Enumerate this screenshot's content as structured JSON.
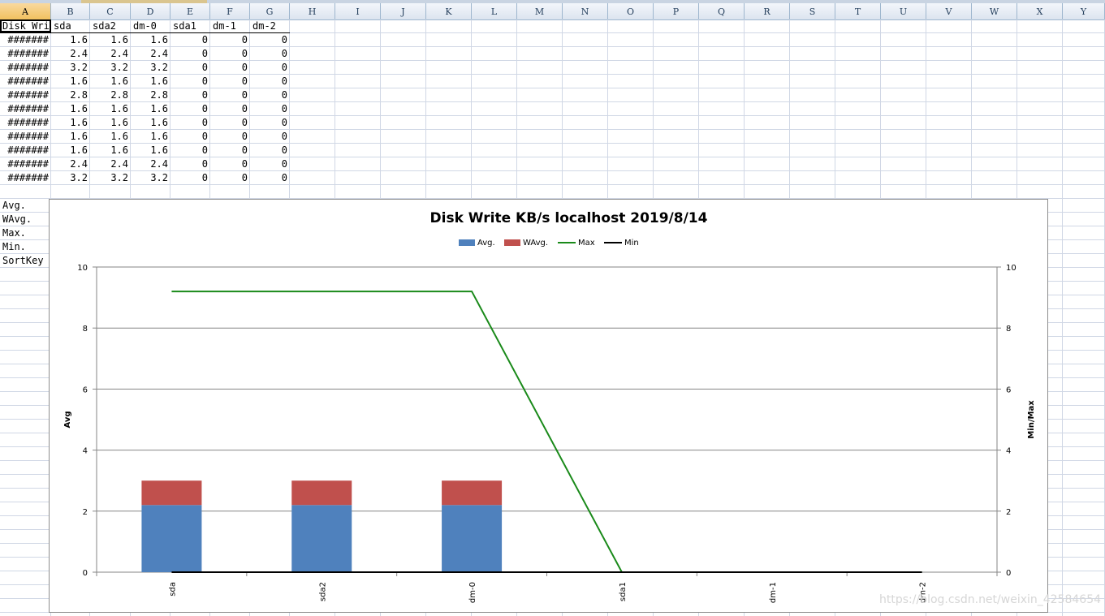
{
  "columns": [
    "A",
    "B",
    "C",
    "D",
    "E",
    "F",
    "G",
    "H",
    "I",
    "J",
    "K",
    "L",
    "M",
    "N",
    "O",
    "P",
    "Q",
    "R",
    "S",
    "T",
    "U",
    "V",
    "W",
    "X",
    "Y"
  ],
  "selected_column": "A",
  "header_row": [
    "Disk Write KB/s localhost",
    "sda",
    "sda2",
    "dm-0",
    "sda1",
    "dm-1",
    "dm-2"
  ],
  "data_rows": [
    [
      "#######",
      "1.6",
      "1.6",
      "1.6",
      "0",
      "0",
      "0"
    ],
    [
      "#######",
      "2.4",
      "2.4",
      "2.4",
      "0",
      "0",
      "0"
    ],
    [
      "#######",
      "3.2",
      "3.2",
      "3.2",
      "0",
      "0",
      "0"
    ],
    [
      "#######",
      "1.6",
      "1.6",
      "1.6",
      "0",
      "0",
      "0"
    ],
    [
      "#######",
      "2.8",
      "2.8",
      "2.8",
      "0",
      "0",
      "0"
    ],
    [
      "#######",
      "1.6",
      "1.6",
      "1.6",
      "0",
      "0",
      "0"
    ],
    [
      "#######",
      "1.6",
      "1.6",
      "1.6",
      "0",
      "0",
      "0"
    ],
    [
      "#######",
      "1.6",
      "1.6",
      "1.6",
      "0",
      "0",
      "0"
    ],
    [
      "#######",
      "1.6",
      "1.6",
      "1.6",
      "0",
      "0",
      "0"
    ],
    [
      "#######",
      "2.4",
      "2.4",
      "2.4",
      "0",
      "0",
      "0"
    ],
    [
      "#######",
      "3.2",
      "3.2",
      "3.2",
      "0",
      "0",
      "0"
    ]
  ],
  "summary_labels": [
    "Avg.",
    "WAvg.",
    "Max.",
    "Min.",
    "SortKey"
  ],
  "watermark": "https://blog.csdn.net/weixin_42584654",
  "colors": {
    "avg": "#4f81bd",
    "wavg": "#c0504d",
    "max": "#1a8a1a",
    "min": "#000000",
    "grid": "#868686",
    "header_bg": "#dce4ef",
    "selected_header": "#f1c15f"
  },
  "chart_data": {
    "type": "bar",
    "title": "Disk Write KB/s localhost  2019/8/14",
    "categories": [
      "sda",
      "sda2",
      "dm-0",
      "sda1",
      "dm-1",
      "dm-2"
    ],
    "stacked": true,
    "series": [
      {
        "name": "Avg.",
        "kind": "bar",
        "values": [
          2.2,
          2.2,
          2.2,
          0,
          0,
          0
        ]
      },
      {
        "name": "WAvg.",
        "kind": "bar",
        "values": [
          0.8,
          0.8,
          0.8,
          0,
          0,
          0
        ]
      },
      {
        "name": "Max",
        "kind": "line",
        "axis": "secondary",
        "values": [
          9.2,
          9.2,
          9.2,
          0,
          0,
          0
        ]
      },
      {
        "name": "Min",
        "kind": "line",
        "axis": "secondary",
        "values": [
          0,
          0,
          0,
          0,
          0,
          0
        ]
      }
    ],
    "ylabel": "Avg",
    "y2label": "Min/Max",
    "ylim": [
      0,
      10
    ],
    "y2lim": [
      0,
      10
    ],
    "yticks": [
      "0",
      "2",
      "4",
      "6",
      "8",
      "10"
    ],
    "grid": true,
    "legend": "top-center"
  }
}
